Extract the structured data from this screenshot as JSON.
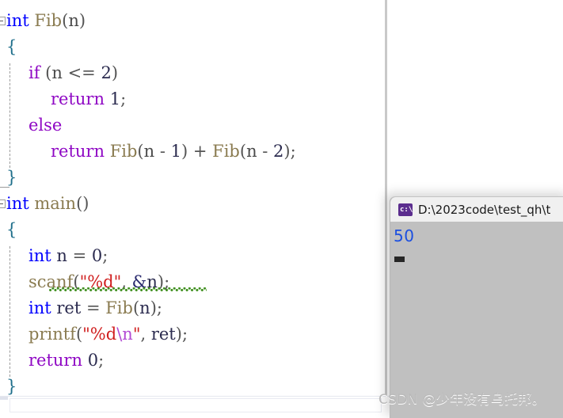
{
  "editor": {
    "language": "c",
    "lines": [
      {
        "indent": 0,
        "fold": "start",
        "tokens": [
          {
            "t": "int",
            "c": "kw"
          },
          {
            "t": " ",
            "c": "plain"
          },
          {
            "t": "Fib",
            "c": "fn"
          },
          {
            "t": "(",
            "c": "punct"
          },
          {
            "t": "n",
            "c": "plain"
          },
          {
            "t": ")",
            "c": "punct"
          }
        ]
      },
      {
        "indent": 0,
        "tokens": [
          {
            "t": "{",
            "c": "brace"
          }
        ]
      },
      {
        "indent": 1,
        "tokens": [
          {
            "t": "if",
            "c": "ctl"
          },
          {
            "t": " (",
            "c": "punct"
          },
          {
            "t": "n",
            "c": "plain"
          },
          {
            "t": " <= ",
            "c": "punct"
          },
          {
            "t": "2",
            "c": "num"
          },
          {
            "t": ")",
            "c": "punct"
          }
        ]
      },
      {
        "indent": 2,
        "tokens": [
          {
            "t": "return",
            "c": "ctl"
          },
          {
            "t": " ",
            "c": "plain"
          },
          {
            "t": "1",
            "c": "num"
          },
          {
            "t": ";",
            "c": "punct"
          }
        ]
      },
      {
        "indent": 1,
        "tokens": [
          {
            "t": "else",
            "c": "ctl"
          }
        ]
      },
      {
        "indent": 2,
        "tokens": [
          {
            "t": "return",
            "c": "ctl"
          },
          {
            "t": " ",
            "c": "plain"
          },
          {
            "t": "Fib",
            "c": "fn"
          },
          {
            "t": "(",
            "c": "punct"
          },
          {
            "t": "n",
            "c": "plain"
          },
          {
            "t": " - ",
            "c": "punct"
          },
          {
            "t": "1",
            "c": "num"
          },
          {
            "t": ") + ",
            "c": "punct"
          },
          {
            "t": "Fib",
            "c": "fn"
          },
          {
            "t": "(",
            "c": "punct"
          },
          {
            "t": "n",
            "c": "plain"
          },
          {
            "t": " - ",
            "c": "punct"
          },
          {
            "t": "2",
            "c": "num"
          },
          {
            "t": ");",
            "c": "punct"
          }
        ]
      },
      {
        "indent": 0,
        "fold": "end",
        "tokens": [
          {
            "t": "}",
            "c": "brace"
          }
        ]
      },
      {
        "indent": 0,
        "fold": "start",
        "tokens": [
          {
            "t": "int",
            "c": "kw"
          },
          {
            "t": " ",
            "c": "plain"
          },
          {
            "t": "main",
            "c": "fn"
          },
          {
            "t": "()",
            "c": "punct"
          }
        ]
      },
      {
        "indent": 0,
        "tokens": [
          {
            "t": "{",
            "c": "brace"
          }
        ]
      },
      {
        "indent": 1,
        "tokens": [
          {
            "t": "int",
            "c": "kw"
          },
          {
            "t": " ",
            "c": "plain"
          },
          {
            "t": "n",
            "c": "ident"
          },
          {
            "t": " = ",
            "c": "punct"
          },
          {
            "t": "0",
            "c": "num"
          },
          {
            "t": ";",
            "c": "punct"
          }
        ]
      },
      {
        "indent": 1,
        "error": true,
        "tokens": [
          {
            "t": "scanf",
            "c": "fn"
          },
          {
            "t": "(",
            "c": "punct"
          },
          {
            "t": "\"%d\"",
            "c": "str"
          },
          {
            "t": ", ",
            "c": "punct"
          },
          {
            "t": "&",
            "c": "amp"
          },
          {
            "t": "n",
            "c": "ident"
          },
          {
            "t": ");",
            "c": "punct"
          }
        ]
      },
      {
        "indent": 1,
        "tokens": [
          {
            "t": "int",
            "c": "kw"
          },
          {
            "t": " ",
            "c": "plain"
          },
          {
            "t": "ret",
            "c": "ident"
          },
          {
            "t": " = ",
            "c": "punct"
          },
          {
            "t": "Fib",
            "c": "fn"
          },
          {
            "t": "(",
            "c": "punct"
          },
          {
            "t": "n",
            "c": "ident"
          },
          {
            "t": ");",
            "c": "punct"
          }
        ]
      },
      {
        "indent": 1,
        "tokens": [
          {
            "t": "printf",
            "c": "fn"
          },
          {
            "t": "(",
            "c": "punct"
          },
          {
            "t": "\"%d",
            "c": "str"
          },
          {
            "t": "\\n",
            "c": "esc"
          },
          {
            "t": "\"",
            "c": "str"
          },
          {
            "t": ", ",
            "c": "punct"
          },
          {
            "t": "ret",
            "c": "ident"
          },
          {
            "t": ");",
            "c": "punct"
          }
        ]
      },
      {
        "indent": 1,
        "tokens": [
          {
            "t": "return",
            "c": "ctl"
          },
          {
            "t": " ",
            "c": "plain"
          },
          {
            "t": "0",
            "c": "num"
          },
          {
            "t": ";",
            "c": "punct"
          }
        ]
      },
      {
        "indent": 0,
        "fold": "end",
        "tokens": [
          {
            "t": "}",
            "c": "brace"
          }
        ]
      }
    ],
    "plain_source": "int Fib(n)\n{\n    if (n <= 2)\n        return 1;\n    else\n        return Fib(n - 1) + Fib(n - 2);\n}\nint main()\n{\n    int n = 0;\n    scanf(\"%d\", &n);\n    int ret = Fib(n);\n    printf(\"%d\\n\", ret);\n    return 0;\n}",
    "colors": {
      "keyword": "#0000ff",
      "control": "#8f08c4",
      "function": "#8a7b50",
      "string": "#d02020",
      "escape": "#b34bd4",
      "identifier": "#2b2b4f",
      "punctuation": "#555555",
      "brace": "#1f6f8b",
      "squiggle_error": "#3f8f1f",
      "background": "#ffffff"
    }
  },
  "console": {
    "title": "D:\\2023code\\test_qh\\t",
    "icon": "console-window-icon",
    "output_lines": [
      "50"
    ],
    "cursor": "block-cursor",
    "colors": {
      "titlebar": "#f0f0f0",
      "body": "#c0c0c0",
      "text": "#1b4fe0"
    }
  },
  "scrollbars": {
    "horizontal": "horizontal-scrollbar",
    "vertical": "vertical-scrollbar"
  },
  "watermark": {
    "text": "CSDN @少年没有乌托邦。"
  }
}
